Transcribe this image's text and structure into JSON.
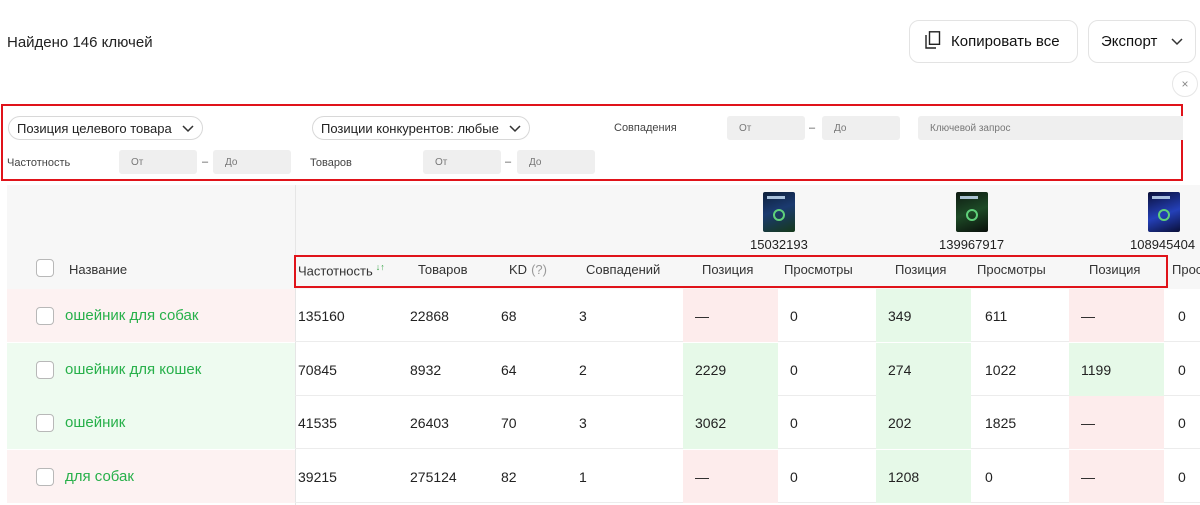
{
  "summary": {
    "found_text": "Найдено 146 ключей"
  },
  "toolbar": {
    "copy_all_label": "Копировать все",
    "export_label": "Экспорт",
    "close_glyph": "×"
  },
  "filters": {
    "target_position_label": "Позиция целевого товара",
    "competitor_positions_label": "Позиции конкурентов: любые",
    "matches_label": "Совпадения",
    "frequency_label": "Частотность",
    "products_label": "Товаров",
    "from_placeholder": "От",
    "to_placeholder": "До",
    "dash": "–",
    "keyword_placeholder": "Ключевой запрос"
  },
  "products": [
    {
      "id": "15032193",
      "image": "dog-collar-product-image"
    },
    {
      "id": "139967917",
      "image": "collar-product-image"
    },
    {
      "id": "108945404",
      "image": "led-collar-product-image"
    }
  ],
  "columns": {
    "name": "Название",
    "frequency": "Частотность",
    "products": "Товаров",
    "kd": "KD",
    "kd_hint": "(?)",
    "matches": "Совпадений",
    "position": "Позиция",
    "views": "Просмотры",
    "views_cut": "Прос"
  },
  "rows": [
    {
      "keyword": "ошейник для собак",
      "name_bg": "red",
      "frequency": "135160",
      "products": "22868",
      "kd": "68",
      "matches": "3",
      "p1_pos": "—",
      "p1_pos_bg": "red",
      "p1_views": "0",
      "p2_pos": "349",
      "p2_pos_bg": "green",
      "p2_views": "611",
      "p3_pos": "—",
      "p3_pos_bg": "red",
      "p3_views": "0"
    },
    {
      "keyword": "ошейник для кошек",
      "name_bg": "green",
      "frequency": "70845",
      "products": "8932",
      "kd": "64",
      "matches": "2",
      "p1_pos": "2229",
      "p1_pos_bg": "green",
      "p1_views": "0",
      "p2_pos": "274",
      "p2_pos_bg": "green",
      "p2_views": "1022",
      "p3_pos": "1199",
      "p3_pos_bg": "green",
      "p3_views": "0"
    },
    {
      "keyword": "ошейник",
      "name_bg": "green",
      "frequency": "41535",
      "products": "26403",
      "kd": "70",
      "matches": "3",
      "p1_pos": "3062",
      "p1_pos_bg": "green",
      "p1_views": "0",
      "p2_pos": "202",
      "p2_pos_bg": "green",
      "p2_views": "1825",
      "p3_pos": "—",
      "p3_pos_bg": "red",
      "p3_views": "0"
    },
    {
      "keyword": "для собак",
      "name_bg": "red",
      "frequency": "39215",
      "products": "275124",
      "kd": "82",
      "matches": "1",
      "p1_pos": "—",
      "p1_pos_bg": "red",
      "p1_views": "0",
      "p2_pos": "1208",
      "p2_pos_bg": "green",
      "p2_views": "0",
      "p3_pos": "—",
      "p3_pos_bg": "red",
      "p3_views": "0"
    }
  ],
  "colors": {
    "accent_green": "#27b04a",
    "highlight_red": "#e0131a",
    "row_red_bg": "#fdecec",
    "row_green_bg": "#e6f9e8"
  }
}
